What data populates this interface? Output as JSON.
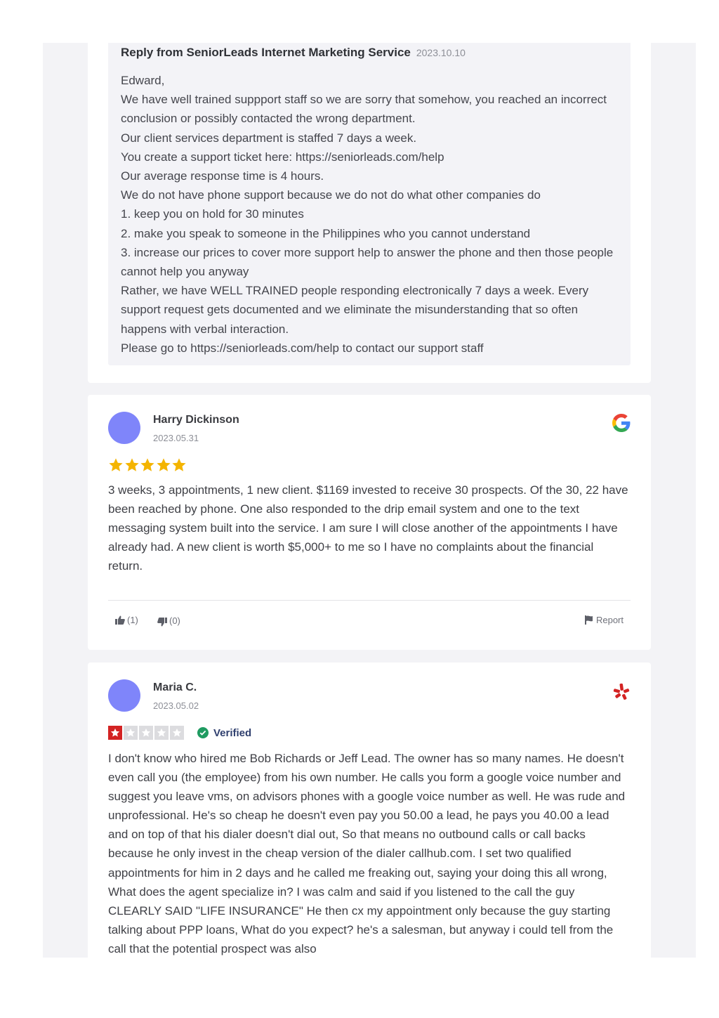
{
  "reply": {
    "title": "Reply from SeniorLeads Internet Marketing Service",
    "date": "2023.10.10",
    "lines": [
      "Edward,",
      "We have well trained suppport staff so we are sorry that somehow, you reached an incorrect conclusion or possibly contacted the wrong department.",
      "Our client services department is staffed 7 days a week.",
      "You create a support ticket here: https://seniorleads.com/help",
      "Our average response time is 4 hours.",
      "We do not have phone support because we do not do what other companies do",
      "1. keep you on hold for 30 minutes",
      "2. make you speak to someone in the Philippines who you cannot understand",
      "3. increase our prices to cover more support help to answer the phone and then those people cannot help you anyway",
      "Rather, we have WELL TRAINED people responding electronically 7 days a week. Every support request gets documented and we eliminate the misunderstanding that so often happens with verbal interaction.",
      "Please go to https://seniorleads.com/help to contact our support staff"
    ]
  },
  "reviews": [
    {
      "name": "Harry Dickinson",
      "date": "2023.05.31",
      "source_icon": "google-icon",
      "rating": 5,
      "rating_max": 5,
      "text": "3 weeks, 3 appointments, 1 new client. $1169 invested to receive 30 prospects. Of the 30, 22 have been reached by phone. One also responded to the drip email system and one to the text messaging system built into the service. I am sure I will close another of the appointments I have already had. A new client is worth $5,000+ to me so I have no complaints about the financial return.",
      "helpful": "(1)",
      "unhelpful": "(0)",
      "report_label": "Report"
    },
    {
      "name": "Maria C.",
      "date": "2023.05.02",
      "source_icon": "yelp-icon",
      "rating": 1,
      "rating_max": 5,
      "verified_label": "Verified",
      "text": "I don't know who hired me Bob Richards or Jeff Lead. The owner has so many names. He doesn't even call you (the employee) from his own number. He calls you form a google voice number and suggest you leave vms, on advisors phones with a google voice number as well. He was rude and unprofessional. He's so cheap he doesn't even pay you 50.00 a lead, he pays you 40.00 a lead and on top of that his dialer doesn't dial out, So that means no outbound calls or call backs because he only invest in the cheap version of the dialer callhub.com. I set two qualified appointments for him in 2 days and he called me freaking out, saying your doing this all wrong, What does the agent specialize in? I was calm and said if you listened to the call the guy CLEARLY SAID \"LIFE INSURANCE\" He then cx my appointment only because the guy starting talking about PPP loans, What do you expect? he's a salesman, but anyway i could tell from the call that the potential prospect was also"
    }
  ],
  "colors": {
    "avatar": "#7f85fa",
    "google_star": "#f4b400",
    "yelp_red": "#d32323",
    "verified_green": "#1f9b61"
  }
}
